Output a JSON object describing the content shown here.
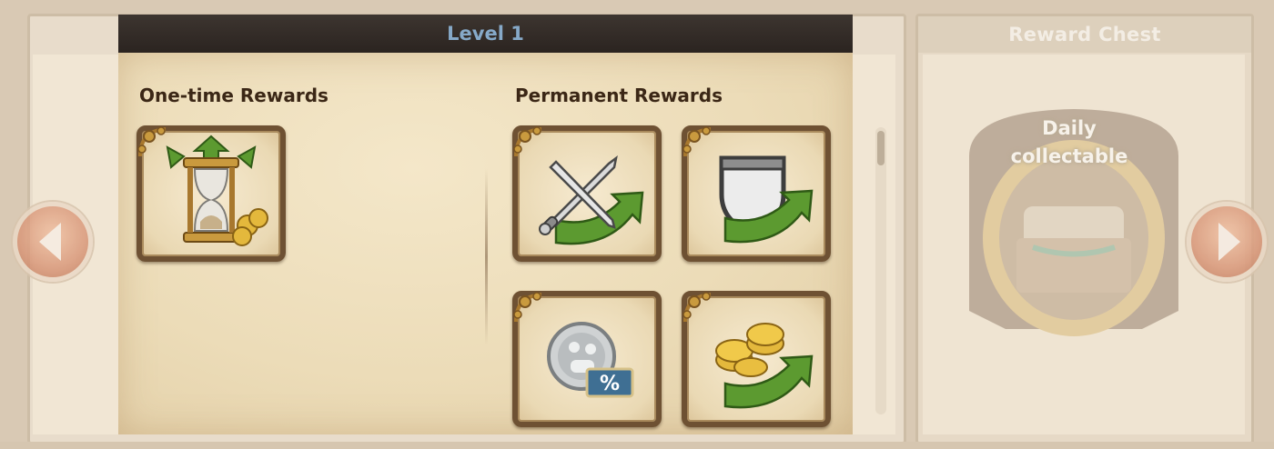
{
  "level_header": {
    "title": "Level 1"
  },
  "reward_chest": {
    "title": "Reward Chest",
    "label_line1": "Daily",
    "label_line2": "collectable"
  },
  "one_time_rewards": {
    "title": "One-time Rewards",
    "items": [
      {
        "icon": "hourglass-gold-upgrade-icon"
      }
    ]
  },
  "permanent_rewards": {
    "title": "Permanent Rewards",
    "items": [
      {
        "icon": "crossed-swords-attack-bonus-icon"
      },
      {
        "icon": "shield-defense-bonus-icon"
      },
      {
        "icon": "silver-coin-percent-discount-icon",
        "badge": "%"
      },
      {
        "icon": "gold-coins-income-bonus-icon"
      }
    ]
  },
  "navigation": {
    "prev_icon": "arrow-left-icon",
    "next_icon": "arrow-right-icon"
  },
  "colors": {
    "header_bg": "#2b2420",
    "header_text": "#86a9c8",
    "slot_border": "#6e5133",
    "upgrade_arrow": "#5c9a30"
  }
}
